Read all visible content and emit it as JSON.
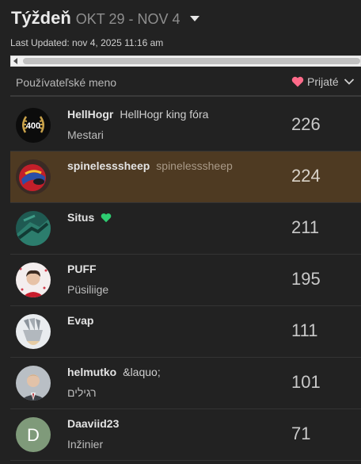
{
  "header": {
    "title": "Týždeň",
    "range": "OKT 29 - NOV 4",
    "last_updated": "Last Updated: nov 4, 2025 11:16 am"
  },
  "table": {
    "col_user": "Používateľské meno",
    "col_received": "Prijaté",
    "rows": [
      {
        "username": "HellHogr",
        "title": "HellHogr king fóra",
        "rank": "Mestari",
        "count": "226",
        "avatar": "laurel-400-badge"
      },
      {
        "username": "spinelesssheep",
        "title": "spinelesssheep",
        "rank": "",
        "count": "224",
        "avatar": "racing-helmet"
      },
      {
        "username": "Situs",
        "title": "",
        "rank": "",
        "count": "211",
        "avatar": "green-abstract",
        "badge": "green-heart-icon"
      },
      {
        "username": "PUFF",
        "title": "",
        "rank": "Püsiliige",
        "count": "195",
        "avatar": "portrait-red-jacket"
      },
      {
        "username": "Evap",
        "title": "",
        "rank": "",
        "count": "111",
        "avatar": "armored-hand"
      },
      {
        "username": "helmutko",
        "title": "&laquo;",
        "rank": "רגילים",
        "count": "101",
        "avatar": "portrait-suit"
      },
      {
        "username": "Daaviid23",
        "title": "",
        "rank": "Inžinier",
        "count": "71",
        "avatar": "letter-d",
        "avatar_letter": "D"
      }
    ]
  },
  "colors": {
    "background": "#222222",
    "highlight_row": "#4e3a22",
    "heart": "#ff6b8a",
    "green_heart": "#2ecc71"
  }
}
